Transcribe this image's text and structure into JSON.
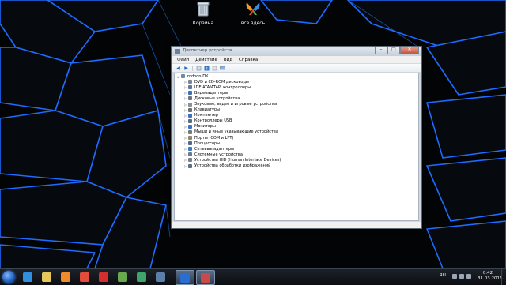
{
  "desktop": {
    "icons": [
      {
        "label": "Корзина",
        "icon": "recycle-bin-icon"
      },
      {
        "label": "все здесь",
        "icon": "butterfly-app-icon"
      }
    ]
  },
  "window": {
    "title": "Диспетчер устройств",
    "controls": {
      "minimize": "–",
      "maximize": "□",
      "close": "✕"
    },
    "menu": [
      "Файл",
      "Действие",
      "Вид",
      "Справка"
    ],
    "toolbar": [
      "back-icon",
      "forward-icon",
      "properties-icon",
      "refresh-icon",
      "help-icon",
      "monitor-icon"
    ],
    "tree": {
      "root": "rodoon-ПК",
      "children": [
        {
          "label": "DVD и CD-ROM дисководы",
          "color": "#7b8794"
        },
        {
          "label": "IDE ATA/ATAPI контроллеры",
          "color": "#5c7aa0"
        },
        {
          "label": "Видеоадаптеры",
          "color": "#3f6fb5"
        },
        {
          "label": "Дисковые устройства",
          "color": "#6b7480"
        },
        {
          "label": "Звуковые, видео и игровые устройства",
          "color": "#8a8f98"
        },
        {
          "label": "Клавиатуры",
          "color": "#6f6f6f"
        },
        {
          "label": "Компьютер",
          "color": "#3a73c4"
        },
        {
          "label": "Контроллеры USB",
          "color": "#5a6c80"
        },
        {
          "label": "Мониторы",
          "color": "#3a73c4"
        },
        {
          "label": "Мыши и иные указывающие устройства",
          "color": "#7a7a7a"
        },
        {
          "label": "Порты (COM и LPT)",
          "color": "#8a8a6a"
        },
        {
          "label": "Процессоры",
          "color": "#4e6a8a"
        },
        {
          "label": "Сетевые адаптеры",
          "color": "#3d7ac0"
        },
        {
          "label": "Системные устройства",
          "color": "#6a7c90"
        },
        {
          "label": "Устройства HID (Human Interface Devices)",
          "color": "#7b7f86"
        },
        {
          "label": "Устройства обработки изображений",
          "color": "#5a6f88"
        }
      ]
    }
  },
  "taskbar": {
    "apps": [
      {
        "icon": "internet-explorer-icon",
        "color": "#2f8fe0"
      },
      {
        "icon": "file-explorer-icon",
        "color": "#e7c65a"
      },
      {
        "icon": "media-player-icon",
        "color": "#f08a2a"
      },
      {
        "icon": "chrome-icon",
        "color": "#e34b3b"
      },
      {
        "icon": "opera-icon",
        "color": "#d32f2f"
      },
      {
        "icon": "torrent-icon",
        "color": "#6aa84f"
      },
      {
        "icon": "network-icon",
        "color": "#3fa36b"
      },
      {
        "icon": "ie-tab-icon",
        "color": "#5b7fa8"
      },
      {
        "icon": "media-icon",
        "color": "#2b6ed1"
      },
      {
        "icon": "device-manager-icon",
        "color": "#c84b4b"
      }
    ],
    "language": "RU",
    "time": "0:42",
    "date": "31.03.2016"
  }
}
